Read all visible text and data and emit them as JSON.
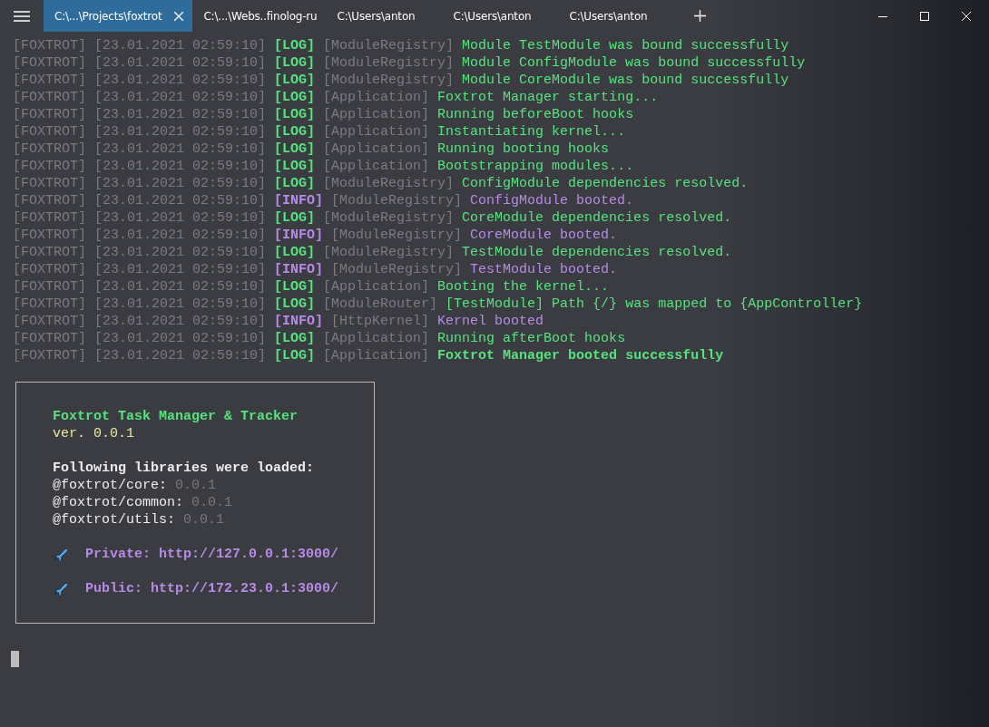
{
  "tabs": [
    {
      "label": "C:\\...\\Projects\\foxtrot",
      "selected": true
    },
    {
      "label": "C:\\...\\Webs..finolog-ru",
      "selected": false
    },
    {
      "label": "C:\\Users\\anton",
      "selected": false
    },
    {
      "label": "C:\\Users\\anton",
      "selected": false
    },
    {
      "label": "C:\\Users\\anton",
      "selected": false
    }
  ],
  "log": [
    {
      "prefix": "[FOXTROT] [23.01.2021 02:59:10]",
      "level": "[LOG]",
      "kind": "log",
      "module": "[ModuleRegistry]",
      "message": "Module TestModule was bound successfully",
      "bold": false
    },
    {
      "prefix": "[FOXTROT] [23.01.2021 02:59:10]",
      "level": "[LOG]",
      "kind": "log",
      "module": "[ModuleRegistry]",
      "message": "Module ConfigModule was bound successfully",
      "bold": false
    },
    {
      "prefix": "[FOXTROT] [23.01.2021 02:59:10]",
      "level": "[LOG]",
      "kind": "log",
      "module": "[ModuleRegistry]",
      "message": "Module CoreModule was bound successfully",
      "bold": false
    },
    {
      "prefix": "[FOXTROT] [23.01.2021 02:59:10]",
      "level": "[LOG]",
      "kind": "log",
      "module": "[Application]",
      "message": "Foxtrot Manager starting...",
      "bold": false
    },
    {
      "prefix": "[FOXTROT] [23.01.2021 02:59:10]",
      "level": "[LOG]",
      "kind": "log",
      "module": "[Application]",
      "message": "Running beforeBoot hooks",
      "bold": false
    },
    {
      "prefix": "[FOXTROT] [23.01.2021 02:59:10]",
      "level": "[LOG]",
      "kind": "log",
      "module": "[Application]",
      "message": "Instantiating kernel...",
      "bold": false
    },
    {
      "prefix": "[FOXTROT] [23.01.2021 02:59:10]",
      "level": "[LOG]",
      "kind": "log",
      "module": "[Application]",
      "message": "Running booting hooks",
      "bold": false
    },
    {
      "prefix": "[FOXTROT] [23.01.2021 02:59:10]",
      "level": "[LOG]",
      "kind": "log",
      "module": "[Application]",
      "message": "Bootstrapping modules...",
      "bold": false
    },
    {
      "prefix": "[FOXTROT] [23.01.2021 02:59:10]",
      "level": "[LOG]",
      "kind": "log",
      "module": "[ModuleRegistry]",
      "message": "ConfigModule dependencies resolved.",
      "bold": false
    },
    {
      "prefix": "[FOXTROT] [23.01.2021 02:59:10]",
      "level": "[INFO]",
      "kind": "info",
      "module": "[ModuleRegistry]",
      "message": "ConfigModule booted.",
      "bold": false
    },
    {
      "prefix": "[FOXTROT] [23.01.2021 02:59:10]",
      "level": "[LOG]",
      "kind": "log",
      "module": "[ModuleRegistry]",
      "message": "CoreModule dependencies resolved.",
      "bold": false
    },
    {
      "prefix": "[FOXTROT] [23.01.2021 02:59:10]",
      "level": "[INFO]",
      "kind": "info",
      "module": "[ModuleRegistry]",
      "message": "CoreModule booted.",
      "bold": false
    },
    {
      "prefix": "[FOXTROT] [23.01.2021 02:59:10]",
      "level": "[LOG]",
      "kind": "log",
      "module": "[ModuleRegistry]",
      "message": "TestModule dependencies resolved.",
      "bold": false
    },
    {
      "prefix": "[FOXTROT] [23.01.2021 02:59:10]",
      "level": "[INFO]",
      "kind": "info",
      "module": "[ModuleRegistry]",
      "message": "TestModule booted.",
      "bold": false
    },
    {
      "prefix": "[FOXTROT] [23.01.2021 02:59:10]",
      "level": "[LOG]",
      "kind": "log",
      "module": "[Application]",
      "message": "Booting the kernel...",
      "bold": false
    },
    {
      "prefix": "[FOXTROT] [23.01.2021 02:59:10]",
      "level": "[LOG]",
      "kind": "log",
      "module": "[ModuleRouter]",
      "message": "[TestModule] Path {/} was mapped to {AppController}",
      "bold": false
    },
    {
      "prefix": "[FOXTROT] [23.01.2021 02:59:10]",
      "level": "[INFO]",
      "kind": "info",
      "module": "[HttpKernel]",
      "message": "Kernel booted",
      "bold": false
    },
    {
      "prefix": "[FOXTROT] [23.01.2021 02:59:10]",
      "level": "[LOG]",
      "kind": "log",
      "module": "[Application]",
      "message": "Running afterBoot hooks",
      "bold": false
    },
    {
      "prefix": "[FOXTROT] [23.01.2021 02:59:10]",
      "level": "[LOG]",
      "kind": "log",
      "module": "[Application]",
      "message": "Foxtrot Manager booted successfully",
      "bold": true
    }
  ],
  "banner": {
    "title": "Foxtrot Task Manager & Tracker",
    "version": "ver. 0.0.1",
    "libraries_heading": "Following libraries were loaded:",
    "libraries": [
      {
        "name": "@foxtrot/core:",
        "version": "0.0.1"
      },
      {
        "name": "@foxtrot/common:",
        "version": "0.0.1"
      },
      {
        "name": "@foxtrot/utils:",
        "version": "0.0.1"
      }
    ],
    "addresses": [
      {
        "label": "Private:",
        "url": "http://127.0.0.1:3000/"
      },
      {
        "label": "Public:",
        "url": "http://172.23.0.1:3000/"
      }
    ]
  }
}
